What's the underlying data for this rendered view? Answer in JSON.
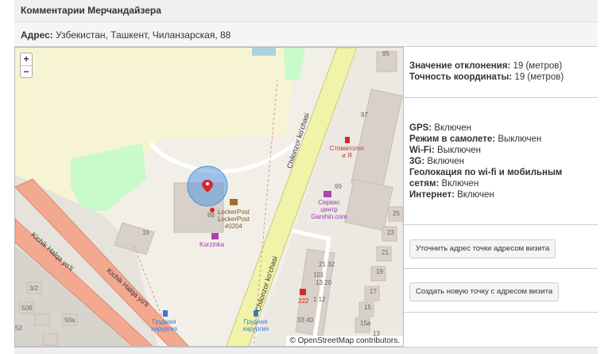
{
  "header": {
    "title": "Комментарии Мерчандайзера"
  },
  "address": {
    "label": "Адрес:",
    "value": "Узбекистан, Ташкент, Чиланзарская, 88"
  },
  "map": {
    "zoom_in": "+",
    "zoom_out": "−",
    "attribution": "© OpenStreetMap contributors.",
    "labels": {
      "street_main_1": "Chilonzor ko'chasi",
      "street_main_2": "Chilonzor ko'chasi",
      "street_left_1": "Kichik Halqa yo'li",
      "street_left_2": "Kichik Halqa yo'li",
      "dentist": "Стоматолог и Я",
      "service_center": "Сервис центр Garshin.com",
      "lockerpost": "LockerPost LockerPost #0204",
      "korzinka": "Korzinka",
      "surgery_1": "Грудная хирургия",
      "surgery_2": "Грудная хирургия",
      "pharmacy": "222",
      "bldg_16": "16",
      "bldg_88": "88",
      "bldg_95": "95",
      "bldg_97": "97",
      "bldg_99": "99",
      "bldg_101": "101",
      "bldg_1320": "13 20",
      "bldg_2132": "21 32",
      "bldg_3340": "33 40",
      "bldg_112": "1 12",
      "bldg_25": "25",
      "bldg_23": "23",
      "bldg_21": "21",
      "bldg_19": "19",
      "bldg_17": "17",
      "bldg_15": "15",
      "bldg_15a": "15a",
      "bldg_13": "13",
      "bldg_50a": "50a",
      "bldg_50b": "50б",
      "bldg_52": "52",
      "bldg_32": "3/2"
    }
  },
  "info": {
    "deviation_label": "Значение отклонения:",
    "deviation_value": "19 (метров)",
    "accuracy_label": "Точность координаты:",
    "accuracy_value": "19 (метров)",
    "gps_label": "GPS:",
    "gps_value": "Включен",
    "airplane_label": "Режим в самолете:",
    "airplane_value": "Выключен",
    "wifi_label": "Wi-Fi:",
    "wifi_value": "Выключен",
    "3g_label": "3G:",
    "3g_value": "Включен",
    "geo_label": "Геолокация по wi-fi и мобильным сетям:",
    "geo_value": "Включен",
    "internet_label": "Интернет:",
    "internet_value": "Включен"
  },
  "buttons": {
    "refine_address": "Уточнить адрес точки адресом визита",
    "create_point": "Создать новую точку с адресом визита"
  },
  "colors": {
    "road_main": "#f1f3a8",
    "road_red": "#f3a98f",
    "park": "#c8facc",
    "building": "#d9d0c9",
    "accuracy_circle": "#4a90e2"
  }
}
